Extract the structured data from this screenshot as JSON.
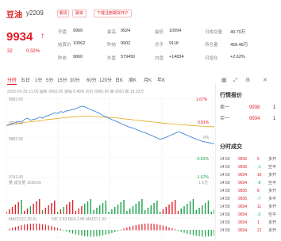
{
  "header": {
    "name": "豆油",
    "code": "y2209",
    "tags": [
      "期货",
      "融资",
      "下载注册期货开户"
    ],
    "price": "9934",
    "arrow": "↑",
    "change": "32",
    "change_pct": "0.32%"
  },
  "stats": [
    {
      "label": "开盘",
      "value": "9960"
    },
    {
      "label": "最高",
      "value": "9924"
    },
    {
      "label": "最低",
      "value": "10094"
    },
    {
      "label": "日成交量",
      "value": "49.70万"
    },
    {
      "label": "结算价",
      "value": "10062"
    },
    {
      "label": "昨结",
      "value": "9902"
    },
    {
      "label": "总手",
      "value": "9118"
    },
    {
      "label": "持仓量",
      "value": "458.48万"
    },
    {
      "label": "昨收",
      "value": "9860"
    },
    {
      "label": "外盘",
      "value": "579450"
    },
    {
      "label": "内盘",
      "value": "+14834"
    },
    {
      "label": "日增仓",
      "value": "+2.62%"
    }
  ],
  "tabs": [
    "分时",
    "五日",
    "1分",
    "5分",
    "15分",
    "30分",
    "60分",
    "120分",
    "日K",
    "周K",
    "月K",
    "年K"
  ],
  "chart": {
    "info": "2022-03-29 21:00 最新 9960.00 涨幅 0.48% 均价 9960.00 量 9063 额 19.33万",
    "ylabels_left": [
      "9982.00",
      "9922.00",
      "9882.00",
      "9742.00"
    ],
    "ylabels_right": [
      "1.67%",
      "0.81%",
      "0%",
      "-0.81%",
      "-1.67%"
    ],
    "vol_label": "量 成交量 1558.00",
    "vol_right": "1.6万",
    "macd_label": "MACD(12,26,9)",
    "macd_vals": "DIF 3.63 DEA 2.85 MACD 1.53",
    "time_labels": [
      "21:00",
      "23:00",
      "10:15",
      "13:30",
      "15:00"
    ]
  },
  "chart_data": {
    "type": "line",
    "series": [
      {
        "values": [
          9900,
          9902,
          9906,
          9908,
          9912,
          9910,
          9918,
          9922,
          9916,
          9918,
          9920,
          9925,
          9922,
          9928,
          9930,
          9934,
          9938,
          9936,
          9942,
          9940,
          9944,
          9946,
          9948,
          9950,
          9955,
          9958,
          9956,
          9952,
          9948,
          9944,
          9940,
          9936,
          9930,
          9926,
          9922,
          9918,
          9914,
          9910,
          9906,
          9902,
          9898,
          9894,
          9892,
          9888,
          9884,
          9880,
          9878,
          9874,
          9870,
          9866,
          9862,
          9858,
          9860,
          9864,
          9868,
          9872,
          9876,
          9880,
          9878,
          9874,
          9870,
          9866,
          9862,
          9858,
          9855,
          9852,
          9850,
          9848,
          9846,
          9844
        ]
      },
      {
        "values": [
          9900,
          9901,
          9903,
          9904,
          9906,
          9907,
          9909,
          9910,
          9911,
          9912,
          9913,
          9914,
          9915,
          9917,
          9918,
          9919,
          9920,
          9921,
          9922,
          9923,
          9924,
          9925,
          9926,
          9926,
          9927,
          9928,
          9928,
          9928,
          9928,
          9927,
          9927,
          9926,
          9926,
          9925,
          9924,
          9924,
          9923,
          9922,
          9921,
          9920,
          9919,
          9918,
          9917,
          9916,
          9915,
          9914,
          9913,
          9912,
          9911,
          9910,
          9909,
          9908,
          9907,
          9906,
          9905,
          9905,
          9904,
          9903,
          9902,
          9902,
          9901,
          9900,
          9900,
          9899,
          9898,
          9898,
          9897,
          9897,
          9896,
          9896
        ]
      }
    ],
    "ylim": [
      9742,
      9982
    ]
  },
  "orderbook": {
    "title": "行情报价",
    "rows": [
      {
        "label": "卖一",
        "price": "9938",
        "vol": "1"
      },
      {
        "label": "买一",
        "price": "9934",
        "vol": "1"
      }
    ]
  },
  "trades": {
    "title": "分时成交",
    "rows": [
      {
        "time": "14:59",
        "price": "9936",
        "vol": "5",
        "type": "多开"
      },
      {
        "time": "14:59",
        "price": "9936",
        "vol": "-1",
        "type": "空平"
      },
      {
        "time": "14:59",
        "price": "9934",
        "vol": "16",
        "type": "多开"
      },
      {
        "time": "14:59",
        "price": "9934",
        "vol": "-8",
        "type": "空平"
      },
      {
        "time": "14:59",
        "price": "9935",
        "vol": "8",
        "type": "多开"
      },
      {
        "time": "14:59",
        "price": "9935",
        "vol": "-7",
        "type": "多平"
      },
      {
        "time": "14:59",
        "price": "9934",
        "vol": "11",
        "type": "多开"
      },
      {
        "time": "14:59",
        "price": "9934",
        "vol": "-2",
        "type": "空平"
      },
      {
        "time": "14:59",
        "price": "9934",
        "vol": "1",
        "type": "多开"
      },
      {
        "time": "14:59",
        "price": "9934",
        "vol": "21",
        "type": "多开"
      }
    ]
  }
}
